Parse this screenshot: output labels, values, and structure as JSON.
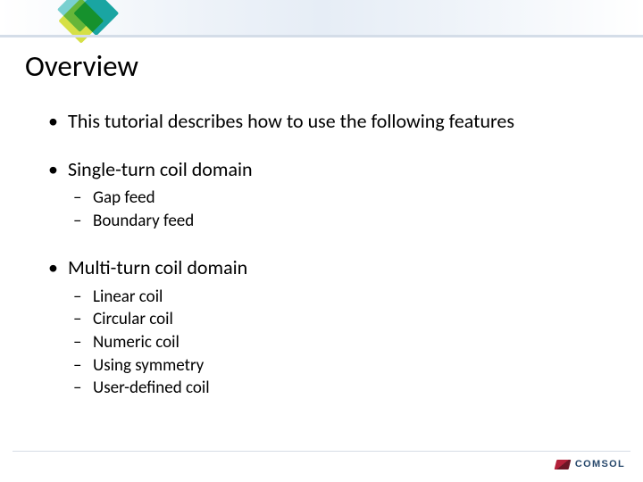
{
  "title": "Overview",
  "bullets": {
    "intro": "This tutorial describes how to use the following features",
    "single": {
      "label": "Single-turn coil domain",
      "items": [
        "Gap feed",
        "Boundary feed"
      ]
    },
    "multi": {
      "label": "Multi-turn coil domain",
      "items": [
        "Linear coil",
        "Circular coil",
        "Numeric coil",
        "Using symmetry",
        "User-defined coil"
      ]
    }
  },
  "footer": {
    "brand": "COMSOL"
  }
}
